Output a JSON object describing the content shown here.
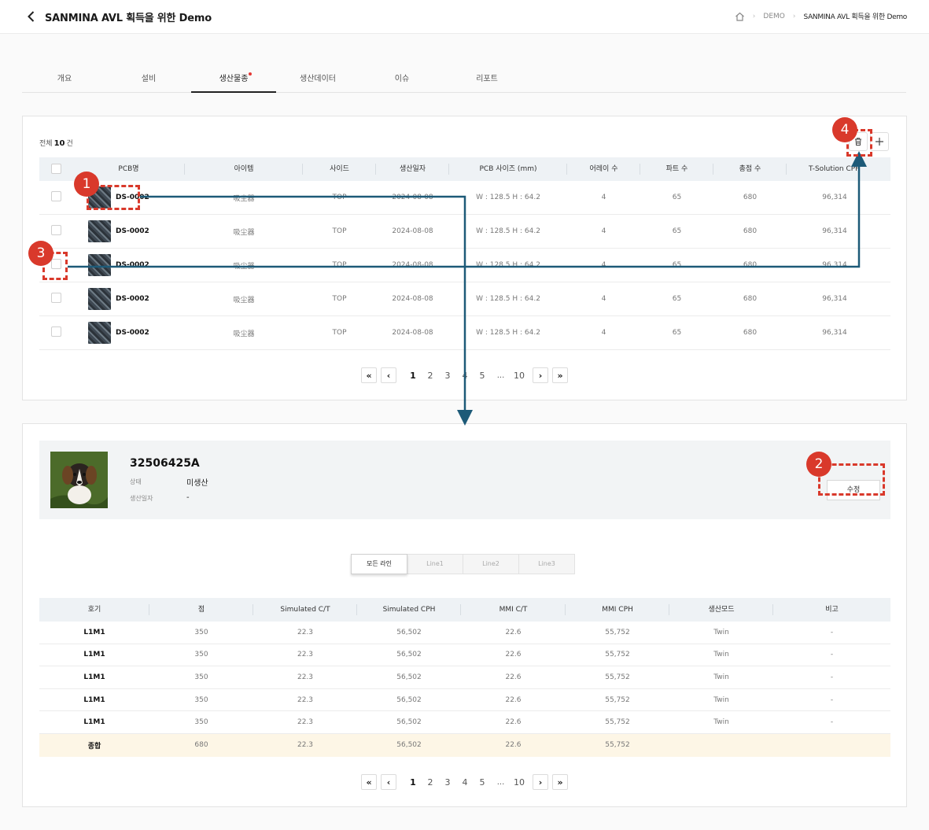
{
  "header": {
    "title": "SANMINA AVL 획득을 위한 Demo",
    "breadcrumb": [
      "DEMO",
      "SANMINA AVL 획득을 위한 Demo"
    ]
  },
  "tabs": [
    {
      "label": "개요"
    },
    {
      "label": "설비"
    },
    {
      "label": "생산물종",
      "active": true,
      "dot": true
    },
    {
      "label": "생산데이터"
    },
    {
      "label": "이슈"
    },
    {
      "label": "리포트"
    }
  ],
  "list": {
    "total_prefix": "전체",
    "total_count": "10",
    "total_suffix": "건",
    "columns": [
      "PCB명",
      "아이템",
      "사이드",
      "생산일자",
      "PCB 사이즈 (mm)",
      "어레이 수",
      "파트 수",
      "총점 수",
      "T-Solution CPH"
    ],
    "rows": [
      {
        "name": "DS-0002",
        "item": "吸尘器",
        "side": "TOP",
        "date": "2024-08-08",
        "size": "W : 128.5    H : 64.2",
        "array": "4",
        "parts": "65",
        "points": "680",
        "cph": "96,314"
      },
      {
        "name": "DS-0002",
        "item": "吸尘器",
        "side": "TOP",
        "date": "2024-08-08",
        "size": "W : 128.5    H : 64.2",
        "array": "4",
        "parts": "65",
        "points": "680",
        "cph": "96,314"
      },
      {
        "name": "DS-0002",
        "item": "吸尘器",
        "side": "TOP",
        "date": "2024-08-08",
        "size": "W : 128.5    H : 64.2",
        "array": "4",
        "parts": "65",
        "points": "680",
        "cph": "96,314"
      },
      {
        "name": "DS-0002",
        "item": "吸尘器",
        "side": "TOP",
        "date": "2024-08-08",
        "size": "W : 128.5    H : 64.2",
        "array": "4",
        "parts": "65",
        "points": "680",
        "cph": "96,314"
      },
      {
        "name": "DS-0002",
        "item": "吸尘器",
        "side": "TOP",
        "date": "2024-08-08",
        "size": "W : 128.5    H : 64.2",
        "array": "4",
        "parts": "65",
        "points": "680",
        "cph": "96,314"
      }
    ]
  },
  "pagination": {
    "first": "«",
    "prev": "‹",
    "next": "›",
    "last": "»",
    "pages": [
      "1",
      "2",
      "3",
      "4",
      "5"
    ],
    "ellipsis": "...",
    "last_page": "10"
  },
  "detail": {
    "product_id": "32506425A",
    "status_label": "상태",
    "status_value": "미생산",
    "date_label": "생산일자",
    "date_value": "-",
    "edit_label": "수정",
    "line_tabs": [
      {
        "label": "모든 라인",
        "active": true
      },
      {
        "label": "Line1"
      },
      {
        "label": "Line2"
      },
      {
        "label": "Line3"
      }
    ],
    "columns": [
      "호기",
      "점",
      "Simulated C/T",
      "Simulated CPH",
      "MMI C/T",
      "MMI CPH",
      "생산모드",
      "비고"
    ],
    "rows": [
      {
        "unit": "L1M1",
        "points": "350",
        "sim_ct": "22.3",
        "sim_cph": "56,502",
        "mmi_ct": "22.6",
        "mmi_cph": "55,752",
        "mode": "Twin",
        "note": "-"
      },
      {
        "unit": "L1M1",
        "points": "350",
        "sim_ct": "22.3",
        "sim_cph": "56,502",
        "mmi_ct": "22.6",
        "mmi_cph": "55,752",
        "mode": "Twin",
        "note": "-"
      },
      {
        "unit": "L1M1",
        "points": "350",
        "sim_ct": "22.3",
        "sim_cph": "56,502",
        "mmi_ct": "22.6",
        "mmi_cph": "55,752",
        "mode": "Twin",
        "note": "-"
      },
      {
        "unit": "L1M1",
        "points": "350",
        "sim_ct": "22.3",
        "sim_cph": "56,502",
        "mmi_ct": "22.6",
        "mmi_cph": "55,752",
        "mode": "Twin",
        "note": "-"
      },
      {
        "unit": "L1M1",
        "points": "350",
        "sim_ct": "22.3",
        "sim_cph": "56,502",
        "mmi_ct": "22.6",
        "mmi_cph": "55,752",
        "mode": "Twin",
        "note": "-"
      }
    ],
    "summary": {
      "unit": "종합",
      "points": "680",
      "sim_ct": "22.3",
      "sim_cph": "56,502",
      "mmi_ct": "22.6",
      "mmi_cph": "55,752",
      "mode": "",
      "note": ""
    }
  },
  "annotations": {
    "badges": [
      "1",
      "2",
      "3",
      "4"
    ],
    "color": "#d9392b",
    "arrow_color": "#1d5a78"
  },
  "icons": [
    "chevron-left-icon",
    "home-icon",
    "chevron-right-icon",
    "trash-icon",
    "plus-icon"
  ]
}
